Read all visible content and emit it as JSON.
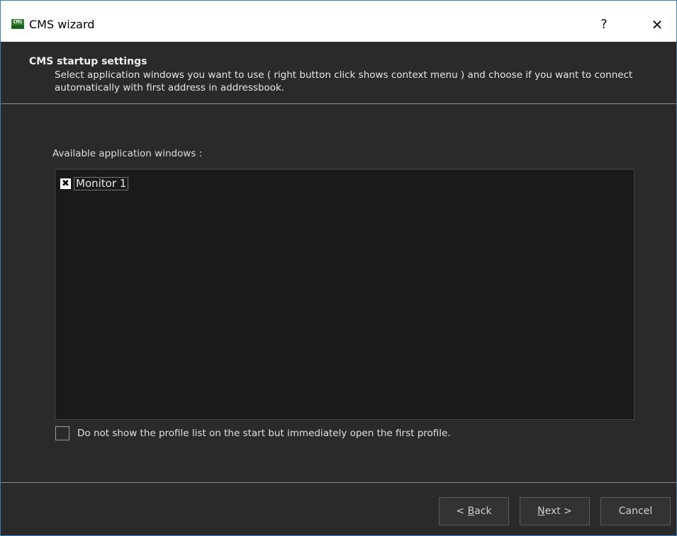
{
  "window": {
    "title": "CMS wizard",
    "app_icon_text": "CMS",
    "help_label": "?",
    "close_label": "✕"
  },
  "header": {
    "title": "CMS startup settings",
    "subtitle": "Select application windows you want to use ( right button click shows context menu ) and choose if you want to connect automatically with first address in addressbook."
  },
  "main": {
    "list_label": "Available application windows :",
    "items": [
      {
        "label": "Monitor 1",
        "checked": true
      }
    ],
    "option": {
      "label": "Do not show the profile list on the start but immediately open the first profile.",
      "checked": false
    }
  },
  "footer": {
    "back": {
      "prefix": "< ",
      "accel": "B",
      "rest": "ack"
    },
    "next": {
      "accel": "N",
      "rest": "ext >"
    },
    "cancel": "Cancel"
  },
  "colors": {
    "background": "#2a2a2a",
    "list_background": "#1a1a1a",
    "titlebar": "#ffffff",
    "window_border": "#3c7fb1",
    "icon_green": "#2e7d32"
  }
}
